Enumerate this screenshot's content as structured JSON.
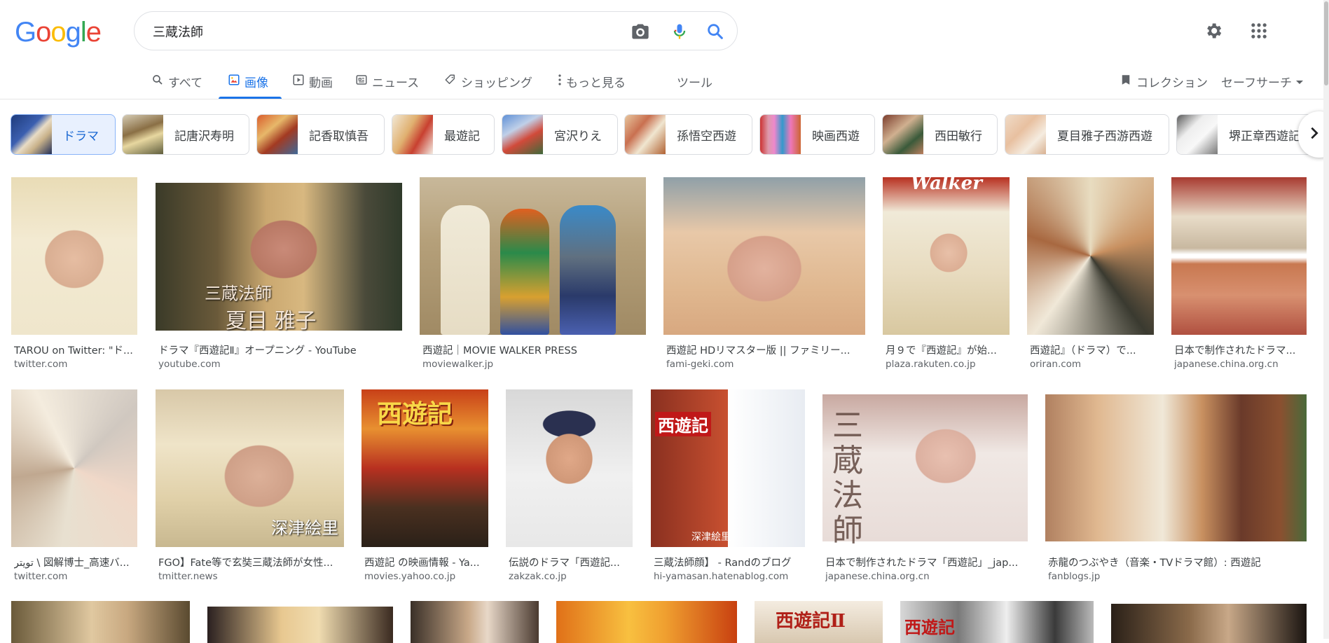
{
  "logo": {
    "letters": [
      "G",
      "o",
      "o",
      "g",
      "l",
      "e"
    ],
    "colors": [
      "#4285f4",
      "#ea4335",
      "#fbbc05",
      "#4285f4",
      "#34a853",
      "#ea4335"
    ]
  },
  "search": {
    "query": "三蔵法師"
  },
  "tabs": [
    {
      "label": "すべて",
      "icon": "search-icon"
    },
    {
      "label": "画像",
      "icon": "image-icon",
      "active": true
    },
    {
      "label": "動画",
      "icon": "play-icon"
    },
    {
      "label": "ニュース",
      "icon": "news-icon"
    },
    {
      "label": "ショッピング",
      "icon": "tag-icon"
    },
    {
      "label": "もっと見る",
      "icon": "more-vert-icon"
    },
    {
      "label": "ツール",
      "icon": ""
    }
  ],
  "right": {
    "collections": "コレクション",
    "safesearch": "セーフサーチ"
  },
  "chips": [
    {
      "label": "ドラマ",
      "selected": true
    },
    {
      "label": "記唐沢寿明"
    },
    {
      "label": "記香取慎吾"
    },
    {
      "label": "最遊記"
    },
    {
      "label": "宮沢りえ"
    },
    {
      "label": "孫悟空西遊"
    },
    {
      "label": "映画西遊"
    },
    {
      "label": "西田敏行"
    },
    {
      "label": "夏目雅子西游西遊"
    },
    {
      "label": "堺正章西遊記"
    }
  ],
  "results_row1": [
    {
      "title": "TAROU on Twitter: \"ド...",
      "source": "twitter.com"
    },
    {
      "title": "ドラマ『西遊記Ⅱ』オープニング - YouTube",
      "source": "youtube.com"
    },
    {
      "title": "西遊記｜MOVIE WALKER PRESS",
      "source": "moviewalker.jp"
    },
    {
      "title": "西遊記 HDリマスター版 || ファミリー...",
      "source": "fami-geki.com"
    },
    {
      "title": "月９で『西遊記』が始...",
      "source": "plaza.rakuten.co.jp"
    },
    {
      "title": "西遊記』（ドラマ）で...",
      "source": "oriran.com"
    },
    {
      "title": "日本で制作されたドラマ...",
      "source": "japanese.china.org.cn"
    }
  ],
  "results_row2": [
    {
      "title": "تويتر \\ 図解博士_高速バ...",
      "source": "twitter.com"
    },
    {
      "title": "FGO】Fate等で玄奘三蔵法師が女性...",
      "source": "tmitter.news"
    },
    {
      "title": "西遊記 の映画情報 - Ya...",
      "source": "movies.yahoo.co.jp"
    },
    {
      "title": "伝説のドラマ「西遊記...",
      "source": "zakzak.co.jp"
    },
    {
      "title": "三蔵法師顔】 - Randのブログ",
      "source": "hi-yamasan.hatenablog.com"
    },
    {
      "title": "日本で制作されたドラマ「西遊記」_jap...",
      "source": "japanese.china.org.cn"
    },
    {
      "title": "赤龍のつぶやき（音楽・TVドラマ館）: 西遊記",
      "source": "fanblogs.jp"
    }
  ],
  "overlays": {
    "r1_2_a": "三蔵法師",
    "r1_2_b": "夏目 雅子",
    "r1_5": "Walker",
    "r2_2": "深津絵里",
    "r2_3": "西遊記",
    "r2_5_a": "西遊記",
    "r2_5_b": "深津絵里",
    "r2_6": "三 蔵 法 師",
    "r3_5": "西遊記Ⅱ",
    "r3_6": "西遊記"
  }
}
